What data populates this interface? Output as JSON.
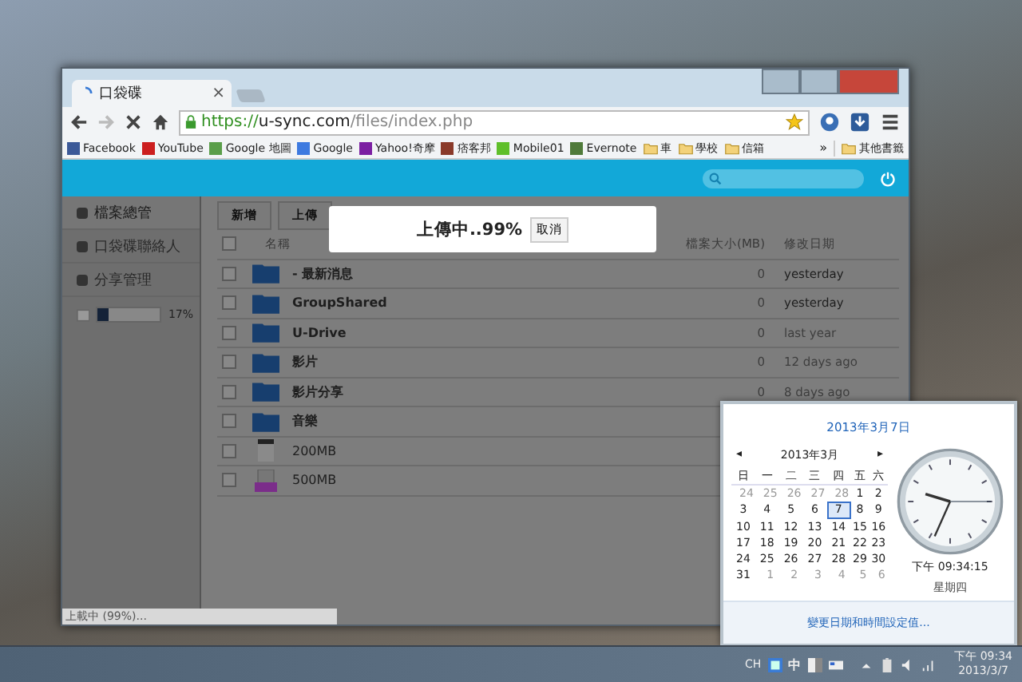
{
  "browser": {
    "tab": {
      "title": "口袋碟",
      "close": "×"
    },
    "url": {
      "secure": "https://",
      "host": "u-sync.com",
      "path": "/files/index.php"
    },
    "bookmarks": [
      {
        "kind": "site",
        "label": "Facebook",
        "color": "#3b5998"
      },
      {
        "kind": "site",
        "label": "YouTube",
        "color": "#cc1f1f"
      },
      {
        "kind": "site",
        "label": "Google 地圖",
        "color": "#5a9e4a"
      },
      {
        "kind": "site",
        "label": "Google",
        "color": "#3d7ae0"
      },
      {
        "kind": "site",
        "label": "Yahoo!奇摩",
        "color": "#7b1fa2"
      },
      {
        "kind": "site",
        "label": "痞客邦",
        "color": "#8a3a2a"
      },
      {
        "kind": "site",
        "label": "Mobile01",
        "color": "#5fbf2a"
      },
      {
        "kind": "site",
        "label": "Evernote",
        "color": "#4f7a3a"
      },
      {
        "kind": "folder",
        "label": "車"
      },
      {
        "kind": "folder",
        "label": "學校"
      },
      {
        "kind": "folder",
        "label": "信箱"
      }
    ],
    "more": "»",
    "other_bookmarks": "其他書籤",
    "status": "上載中 (99%)..."
  },
  "app": {
    "sidebar": [
      {
        "label": "檔案總管",
        "selected": true
      },
      {
        "label": "口袋碟聯絡人",
        "selected": false
      },
      {
        "label": "分享管理",
        "selected": false
      }
    ],
    "storage": {
      "level": 0.17,
      "reading": "17%"
    },
    "toolbar": [
      "新增",
      "上傳"
    ],
    "upload_dialog": {
      "message": "上傳中..99%",
      "cancel": "取消"
    },
    "columns": [
      "名稱",
      "檔案大小(MB)",
      "修改日期"
    ],
    "select_all": {
      "checked": false
    },
    "rows": [
      {
        "kind": "folder",
        "name": "- 最新消息",
        "size": "0",
        "date": "yesterday",
        "recent": true,
        "checked": false
      },
      {
        "kind": "folder",
        "name": "GroupShared",
        "size": "0",
        "date": "yesterday",
        "recent": true,
        "checked": false
      },
      {
        "kind": "folder",
        "name": "U-Drive",
        "size": "0",
        "date": "last year",
        "recent": false,
        "checked": false
      },
      {
        "kind": "folder",
        "name": "影片",
        "size": "0",
        "date": "12 days ago",
        "recent": false,
        "checked": false
      },
      {
        "kind": "folder",
        "name": "影片分享",
        "size": "0",
        "date": "8 days ago",
        "recent": false,
        "checked": false
      },
      {
        "kind": "folder",
        "name": "音樂",
        "checked": false
      },
      {
        "kind": "file",
        "name": "200MB",
        "checked": false
      },
      {
        "kind": "archive",
        "name": "500MB",
        "checked": false
      }
    ]
  },
  "calendar": {
    "date_title": "2013年3月7日",
    "month": "2013年3月",
    "prev": "◂",
    "next": "▸",
    "weekdays": [
      "日",
      "一",
      "二",
      "三",
      "四",
      "五",
      "六"
    ],
    "days": [
      {
        "d": "24",
        "other": true,
        "selected": false
      },
      {
        "d": "25",
        "other": true,
        "selected": false
      },
      {
        "d": "26",
        "other": true,
        "selected": false
      },
      {
        "d": "27",
        "other": true,
        "selected": false
      },
      {
        "d": "28",
        "other": true,
        "selected": false
      },
      {
        "d": "1",
        "other": false,
        "selected": false
      },
      {
        "d": "2",
        "other": false,
        "selected": false
      },
      {
        "d": "3",
        "other": false,
        "selected": false
      },
      {
        "d": "4",
        "other": false,
        "selected": false
      },
      {
        "d": "5",
        "other": false,
        "selected": false
      },
      {
        "d": "6",
        "other": false,
        "selected": false
      },
      {
        "d": "7",
        "other": false,
        "selected": true
      },
      {
        "d": "8",
        "other": false,
        "selected": false
      },
      {
        "d": "9",
        "other": false,
        "selected": false
      },
      {
        "d": "10",
        "other": false,
        "selected": false
      },
      {
        "d": "11",
        "other": false,
        "selected": false
      },
      {
        "d": "12",
        "other": false,
        "selected": false
      },
      {
        "d": "13",
        "other": false,
        "selected": false
      },
      {
        "d": "14",
        "other": false,
        "selected": false
      },
      {
        "d": "15",
        "other": false,
        "selected": false
      },
      {
        "d": "16",
        "other": false,
        "selected": false
      },
      {
        "d": "17",
        "other": false,
        "selected": false
      },
      {
        "d": "18",
        "other": false,
        "selected": false
      },
      {
        "d": "19",
        "other": false,
        "selected": false
      },
      {
        "d": "20",
        "other": false,
        "selected": false
      },
      {
        "d": "21",
        "other": false,
        "selected": false
      },
      {
        "d": "22",
        "other": false,
        "selected": false
      },
      {
        "d": "23",
        "other": false,
        "selected": false
      },
      {
        "d": "24",
        "other": false,
        "selected": false
      },
      {
        "d": "25",
        "other": false,
        "selected": false
      },
      {
        "d": "26",
        "other": false,
        "selected": false
      },
      {
        "d": "27",
        "other": false,
        "selected": false
      },
      {
        "d": "28",
        "other": false,
        "selected": false
      },
      {
        "d": "29",
        "other": false,
        "selected": false
      },
      {
        "d": "30",
        "other": false,
        "selected": false
      },
      {
        "d": "31",
        "other": false,
        "selected": false
      },
      {
        "d": "1",
        "other": true,
        "selected": false
      },
      {
        "d": "2",
        "other": true,
        "selected": false
      },
      {
        "d": "3",
        "other": true,
        "selected": false
      },
      {
        "d": "4",
        "other": true,
        "selected": false
      },
      {
        "d": "5",
        "other": true,
        "selected": false
      },
      {
        "d": "6",
        "other": true,
        "selected": false
      }
    ],
    "time": "下午 09:34:15",
    "weekday": "星期四",
    "settings_link": "變更日期和時間設定值..."
  },
  "taskbar": {
    "language": "CH",
    "ime": "中",
    "time": "下午 09:34",
    "date": "2013/3/7"
  }
}
